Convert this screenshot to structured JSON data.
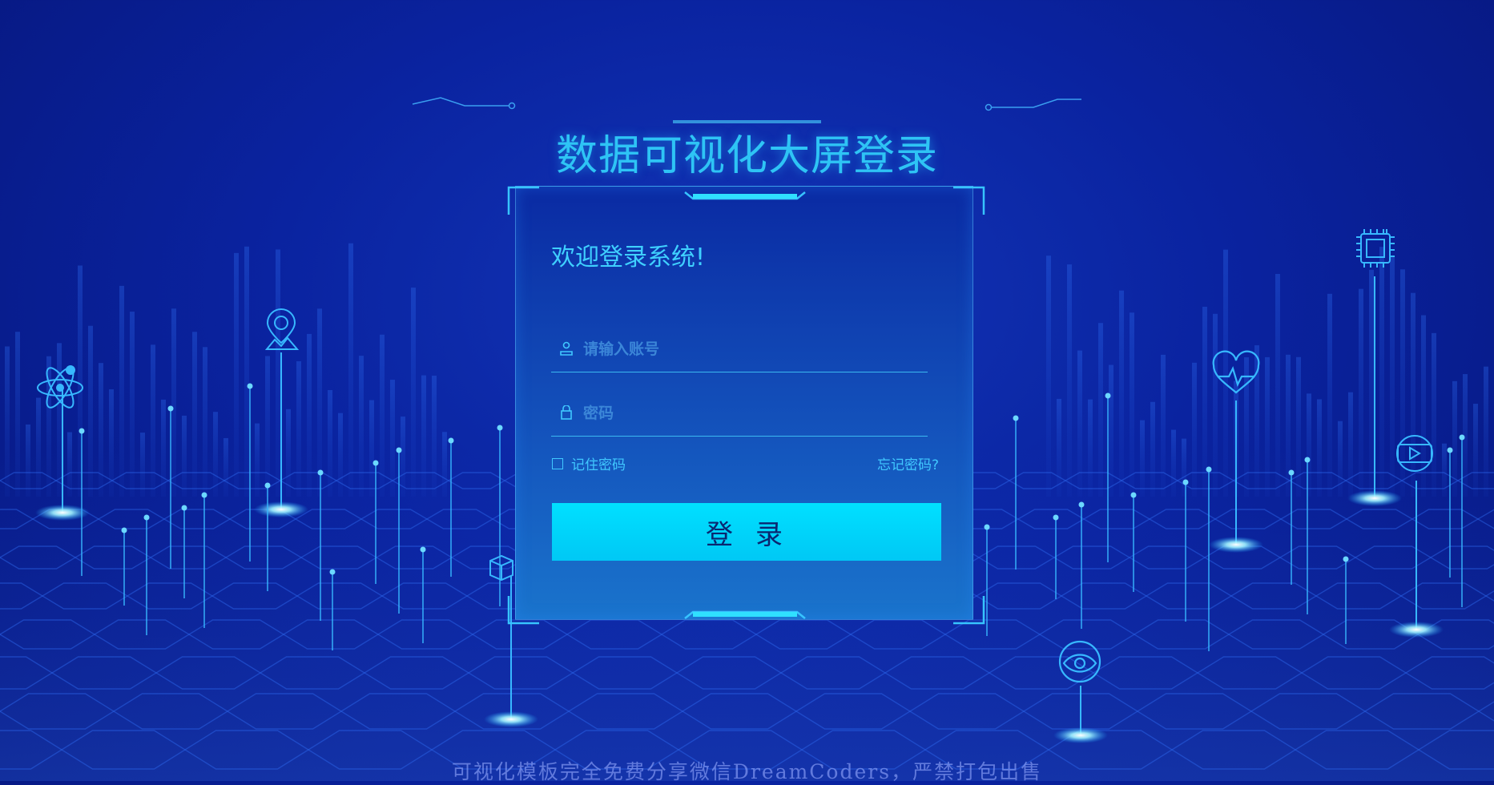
{
  "title": "数据可视化大屏登录",
  "login": {
    "welcome": "欢迎登录系统!",
    "account_placeholder": "请输入账号",
    "password_placeholder": "密码",
    "remember_label": "记住密码",
    "forgot_label": "忘记密码?",
    "submit_label": "登录"
  },
  "footer": "可视化模板完全免费分享微信DreamCoders，严禁打包出售",
  "icons": [
    "atom-icon",
    "location-pin-icon",
    "chip-icon",
    "heart-pulse-icon",
    "video-play-icon",
    "eye-icon",
    "cube-icon",
    "user-icon",
    "lock-icon"
  ],
  "colors": {
    "accent": "#2ec4f5",
    "button": "#00d4f8",
    "background": "#0a23a0"
  }
}
